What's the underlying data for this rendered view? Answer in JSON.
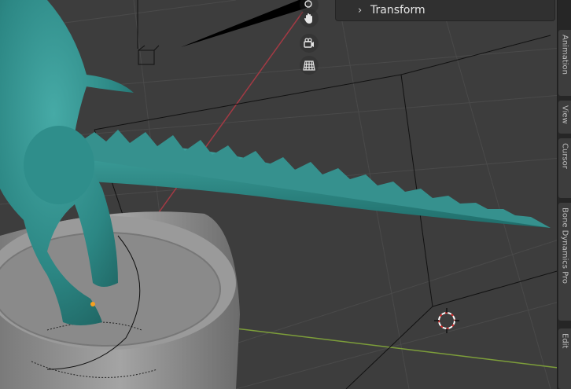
{
  "panel": {
    "transform_label": "Transform",
    "transform_chevron": "›"
  },
  "navigation_gizmo": [
    {
      "name": "hand-pan-icon",
      "icon": "hand"
    },
    {
      "name": "camera-view-icon",
      "icon": "camera"
    },
    {
      "name": "grid-ortho-icon",
      "icon": "grid"
    }
  ],
  "sidebar": {
    "tabs": [
      {
        "label": "Animation"
      },
      {
        "label": "View"
      },
      {
        "label": "Cursor"
      },
      {
        "label": "Bone Dynamics Pro"
      },
      {
        "label": "Edit"
      }
    ]
  },
  "colors": {
    "viewport_bg": "#3d3d3d",
    "model_teal": "#2e8b88",
    "pedestal_grey": "#8e8e8e",
    "x_axis": "#a33a44",
    "y_axis": "#7d9e3a"
  }
}
